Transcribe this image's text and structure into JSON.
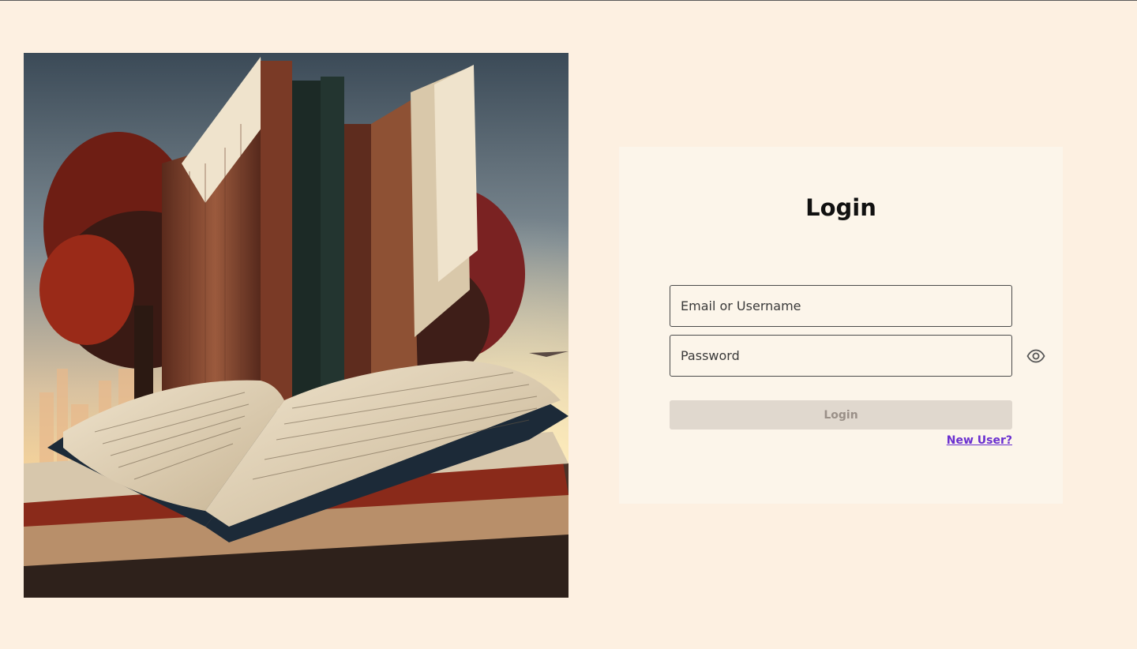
{
  "login": {
    "title": "Login",
    "email_placeholder": "Email or Username",
    "password_placeholder": "Password",
    "submit_label": "Login",
    "new_user_link": "New User?",
    "password_toggle_icon": "eye-icon"
  },
  "hero": {
    "description": "Illustration of an open book on a stack of books with tall books and autumn trees behind it",
    "icon": "illustration"
  },
  "colors": {
    "page_background": "#fdf0e1",
    "card_background": "#fcf5ea",
    "link": "#6a2fd0",
    "disabled_button_bg": "#e0d8ce",
    "disabled_button_text": "#9a9088"
  }
}
